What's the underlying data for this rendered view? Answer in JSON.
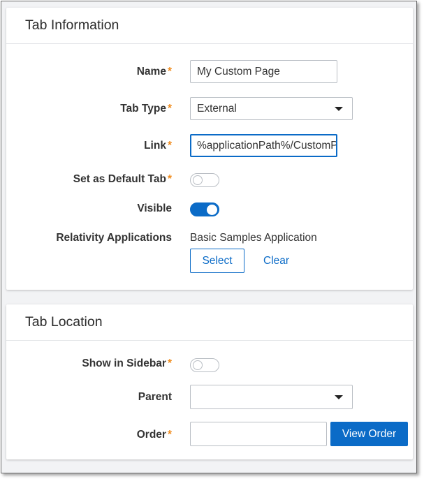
{
  "tab_information": {
    "title": "Tab Information",
    "name": {
      "label": "Name",
      "value": "My Custom Page"
    },
    "tab_type": {
      "label": "Tab Type",
      "value": "External"
    },
    "link": {
      "label": "Link",
      "value": "%applicationPath%/CustomPage"
    },
    "default_tab": {
      "label": "Set as Default Tab",
      "on": false
    },
    "visible": {
      "label": "Visible",
      "on": true
    },
    "applications": {
      "label": "Relativity Applications",
      "value": "Basic Samples Application",
      "select_label": "Select",
      "clear_label": "Clear"
    }
  },
  "tab_location": {
    "title": "Tab Location",
    "show_in_sidebar": {
      "label": "Show in Sidebar",
      "on": false
    },
    "parent": {
      "label": "Parent",
      "value": ""
    },
    "order": {
      "label": "Order",
      "value": "",
      "view_order_label": "View Order"
    }
  },
  "required_marker": "*",
  "colors": {
    "accent": "#0b6bc7",
    "required": "#f08c1d"
  }
}
